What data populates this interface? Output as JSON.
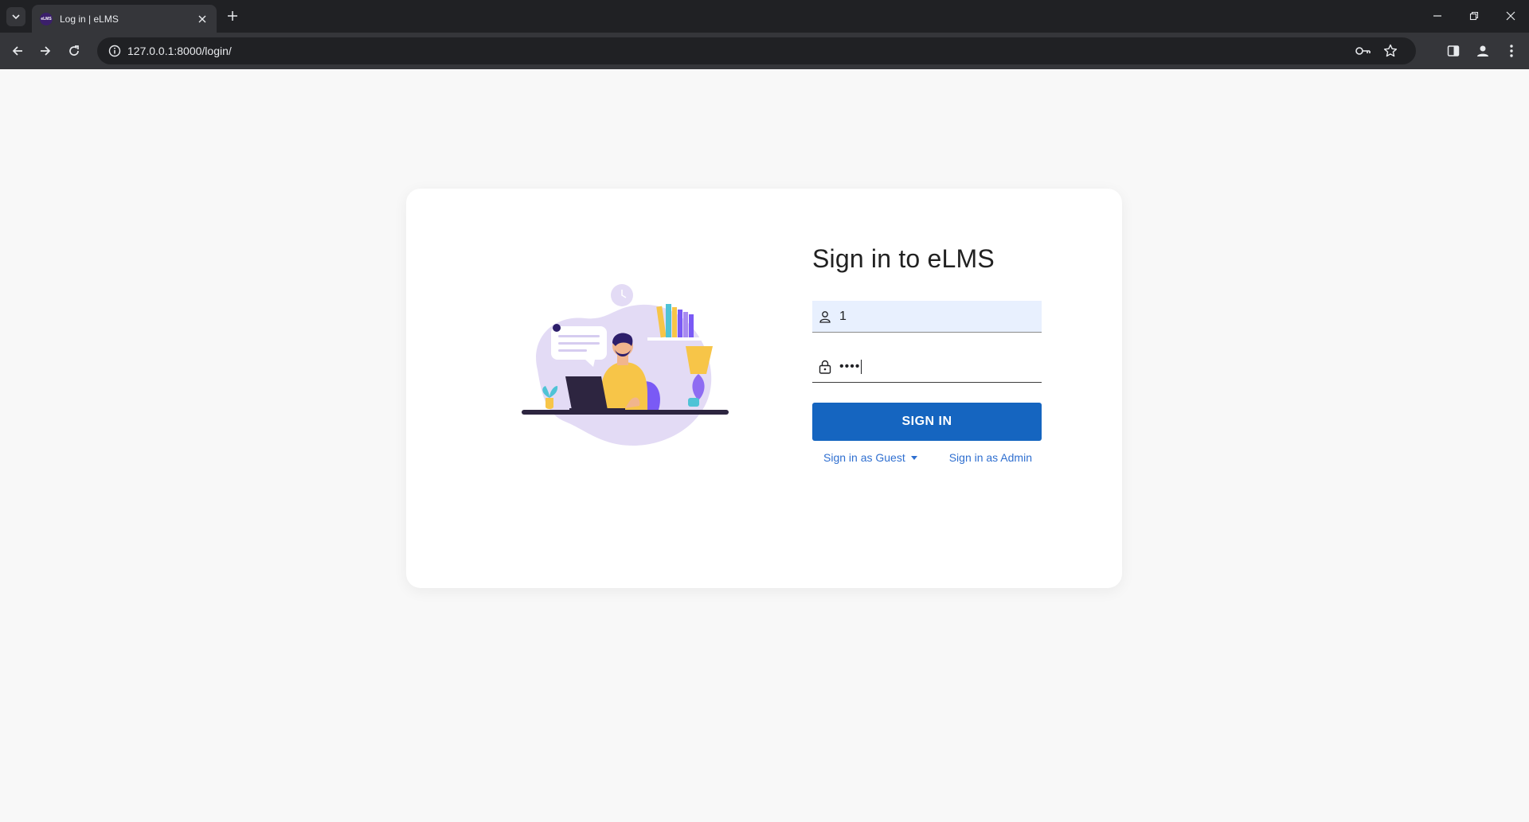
{
  "browser": {
    "tab_title": "Log in | eLMS",
    "favicon_text": "eLMS",
    "url": "127.0.0.1:8000/login/"
  },
  "login": {
    "heading": "Sign in to eLMS",
    "username_value": "1",
    "password_masked": "••••",
    "signin_label": "SIGN IN",
    "guest_label": "Sign in as Guest",
    "admin_label": "Sign in as Admin"
  },
  "colors": {
    "primary_button": "#1565c0",
    "link": "#2f6fd0",
    "autofill_bg": "#e8f0fe"
  }
}
